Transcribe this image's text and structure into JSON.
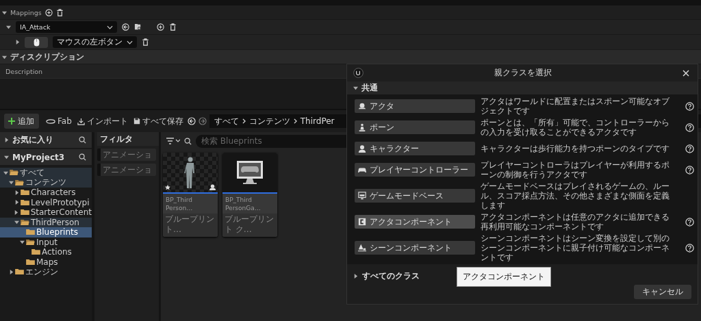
{
  "details": {
    "mappings": {
      "label": "Mappings",
      "expanded": true
    },
    "action": {
      "expanded": true,
      "value": "IA_Attack"
    },
    "binding": {
      "expanded": false,
      "key": "マウスの左ボタン"
    },
    "section": {
      "label": "ディスクリプション",
      "expanded": true
    },
    "description_label": "Description"
  },
  "content_browser": {
    "toolbar": {
      "add": "追加",
      "fab": "Fab",
      "import": "インポート",
      "save_all": "すべて保存"
    },
    "breadcrumbs": [
      "すべて",
      "コンテンツ",
      "ThirdPer"
    ],
    "favorites": {
      "label": "お気に入り",
      "expanded": false
    },
    "project": {
      "label": "MyProject3",
      "expanded": true
    },
    "tree": [
      {
        "label": "すべて",
        "expanded": true,
        "highlighted": true,
        "selected": false,
        "children": [
          {
            "label": "コンテンツ",
            "expanded": true,
            "highlighted": true,
            "selected": false,
            "children": [
              {
                "label": "Characters",
                "expanded": false,
                "highlighted": false,
                "selected": false
              },
              {
                "label": "LevelPrototypi",
                "expanded": false,
                "highlighted": false,
                "selected": false
              },
              {
                "label": "StarterContent",
                "expanded": false,
                "highlighted": false,
                "selected": false
              },
              {
                "label": "ThirdPerson",
                "expanded": true,
                "highlighted": true,
                "selected": false,
                "children": [
                  {
                    "label": "Blueprints",
                    "highlighted": false,
                    "selected": true
                  },
                  {
                    "label": "Input",
                    "expanded": true,
                    "highlighted": false,
                    "selected": false,
                    "children": [
                      {
                        "label": "Actions",
                        "highlighted": false,
                        "selected": false
                      }
                    ]
                  },
                  {
                    "label": "Maps",
                    "highlighted": false,
                    "selected": false
                  }
                ]
              }
            ]
          },
          {
            "label": "エンジン",
            "expanded": false,
            "highlighted": false,
            "selected": false
          }
        ]
      }
    ],
    "filters": {
      "title": "フィルタ",
      "items": [
        "アニメーショ",
        "アニメーショ"
      ]
    },
    "search": {
      "placeholder": "検索 Blueprints"
    },
    "assets": [
      {
        "kind": "picture",
        "name_lines": [
          "BP_Third",
          "Person…"
        ],
        "type": "ブループリント…"
      },
      {
        "kind": "icon",
        "name_lines": [
          "BP_Third",
          "PersonGa…"
        ],
        "type": "ブループリント ク…"
      }
    ]
  },
  "dialog": {
    "title": "親クラスを選択",
    "section": {
      "label": "共通",
      "expanded": true
    },
    "classes": [
      {
        "label": "アクタ",
        "description": "アクタはワールドに配置またはスポーン可能なオブジェクトです",
        "help": true,
        "hovered": false
      },
      {
        "label": "ポーン",
        "description": "ポーンとは、「所有」可能で、コントローラーからの入力を受け取ることができるアクタです",
        "help": true,
        "hovered": false
      },
      {
        "label": "キャラクター",
        "description": "キャラクターは歩行能力を持つポーンのタイプです",
        "help": true,
        "hovered": false
      },
      {
        "label": "プレイヤーコントローラー",
        "description": "プレイヤーコントローラはプレイヤーが利用するポーンの制御を行うアクタです",
        "help": true,
        "hovered": false
      },
      {
        "label": "ゲームモードベース",
        "description": "ゲームモードベースはプレイされるゲームの、ルール、スコア採点方法、その他さまざまな側面を定義します",
        "help": false,
        "hovered": false
      },
      {
        "label": "アクタコンポーネント",
        "description": "アクタコンポーネントは任意のアクタに追加できる再利用可能なコンポーネントです",
        "help": true,
        "hovered": true
      },
      {
        "label": "シーンコンポーネント",
        "description": "シーンコンポーネントはシーン変換を設定して別のシーンコンポーネントに親子付け可能なコンポーネントです",
        "help": true,
        "hovered": false
      }
    ],
    "all_classes": {
      "label": "すべてのクラス",
      "expanded": false
    },
    "cancel": "キャンセル",
    "tooltip": "アクタコンポーネント"
  }
}
